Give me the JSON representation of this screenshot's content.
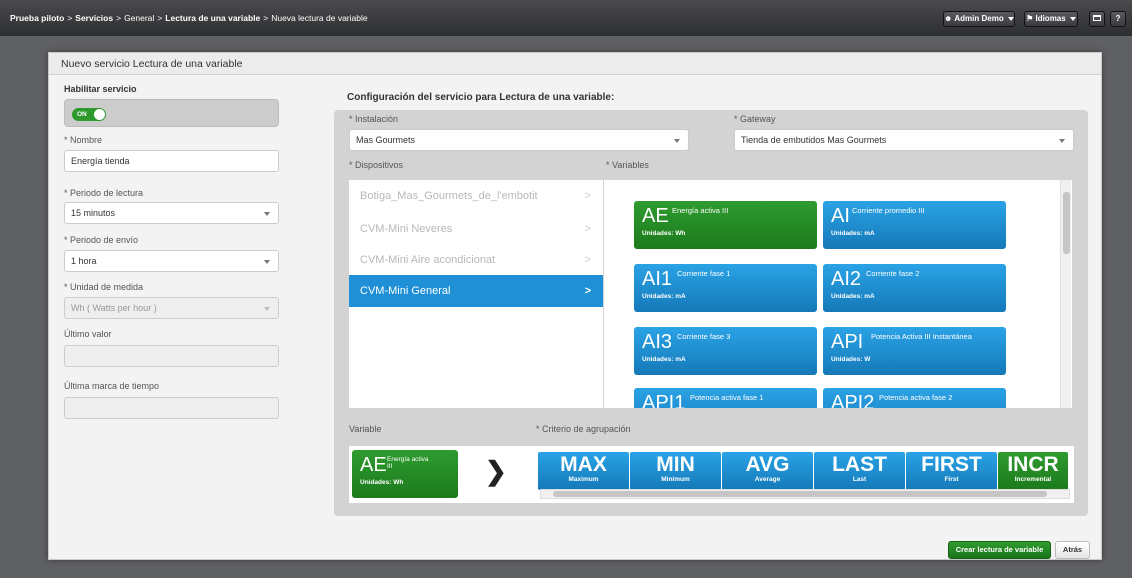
{
  "topbar": {
    "breadcrumb": [
      "Prueba piloto",
      "Servicios",
      "General",
      "Lectura de una variable",
      "Nueva lectura de variable"
    ],
    "separator": ">",
    "user_label": "Admin Demo",
    "lang_label": "Idiomas",
    "help_label": "?"
  },
  "panel": {
    "title": "Nuevo servicio Lectura de una variable"
  },
  "left": {
    "enable_label": "Habilitar servicio",
    "toggle_label": "ON",
    "name_label": "* Nombre",
    "name_value": "Energía tienda",
    "read_period_label": "* Periodo de lectura",
    "read_period_value": "15 minutos",
    "send_period_label": "* Periodo de envío",
    "send_period_value": "1 hora",
    "unit_label": "* Unidad de medida",
    "unit_value": "Wh ( Watts per hour )",
    "last_value_label": "Último valor",
    "last_value": "",
    "last_timestamp_label": "Última marca de tiempo",
    "last_timestamp": ""
  },
  "config": {
    "title": "Configuración del servicio para Lectura de una variable:",
    "installation_label": "* Instalación",
    "installation_value": "Mas Gourmets",
    "gateway_label": "* Gateway",
    "gateway_value": "Tienda de embutidos Mas Gourmets",
    "devices_label": "* Dispositivos",
    "variables_label": "* Variables",
    "devices": [
      {
        "label": "Botiga_Mas_Gourmets_de_l'embotit",
        "active": false
      },
      {
        "label": "CVM-Mini Neveres",
        "active": false
      },
      {
        "label": "CVM-Mini Aire acondicionat",
        "active": false
      },
      {
        "label": "CVM-Mini General",
        "active": true
      }
    ],
    "chevron": ">",
    "variables": [
      {
        "abbr": "AE",
        "name": "Energía activa III",
        "units": "Unidades: Wh",
        "color": "#228b22"
      },
      {
        "abbr": "AI",
        "name": "Corriente promedio III",
        "units": "Unidades: mA",
        "color": "#1e8fd6"
      },
      {
        "abbr": "AI1",
        "name": "Corriente fase 1",
        "units": "Unidades: mA",
        "color": "#1e8fd6"
      },
      {
        "abbr": "AI2",
        "name": "Corriente fase 2",
        "units": "Unidades: mA",
        "color": "#1e8fd6"
      },
      {
        "abbr": "AI3",
        "name": "Corriente fase 3",
        "units": "Unidades: mA",
        "color": "#1e8fd6"
      },
      {
        "abbr": "API",
        "name": "Potencia Activa III Instantánea",
        "units": "Unidades: W",
        "color": "#1e8fd6"
      },
      {
        "abbr": "API1",
        "name": "Potencia activa fase 1",
        "units": "",
        "color": "#1e8fd6"
      },
      {
        "abbr": "API2",
        "name": "Potencia activa fase 2",
        "units": "",
        "color": "#1e8fd6"
      }
    ],
    "variable_label": "Variable",
    "grouping_label": "* Criterio de agrupación",
    "selected_variable": {
      "abbr": "AE",
      "name": "Energía activa III",
      "units": "Unidades: Wh"
    },
    "arrow": "❯",
    "criteria": [
      {
        "big": "MAX",
        "small": "Maximum",
        "color": "#1e8fd6"
      },
      {
        "big": "MIN",
        "small": "Minimum",
        "color": "#1e8fd6"
      },
      {
        "big": "AVG",
        "small": "Average",
        "color": "#1e8fd6"
      },
      {
        "big": "LAST",
        "small": "Last",
        "color": "#1e8fd6"
      },
      {
        "big": "FIRST",
        "small": "First",
        "color": "#1e8fd6"
      },
      {
        "big": "INCR",
        "small": "Incremental",
        "color": "#228b22"
      }
    ]
  },
  "footer": {
    "create_label": "Crear lectura de variable",
    "back_label": "Atrás"
  },
  "colors": {
    "accent_blue": "#1e8fd6",
    "accent_green": "#228b22",
    "topbar_bg": "#3a3b3e"
  }
}
